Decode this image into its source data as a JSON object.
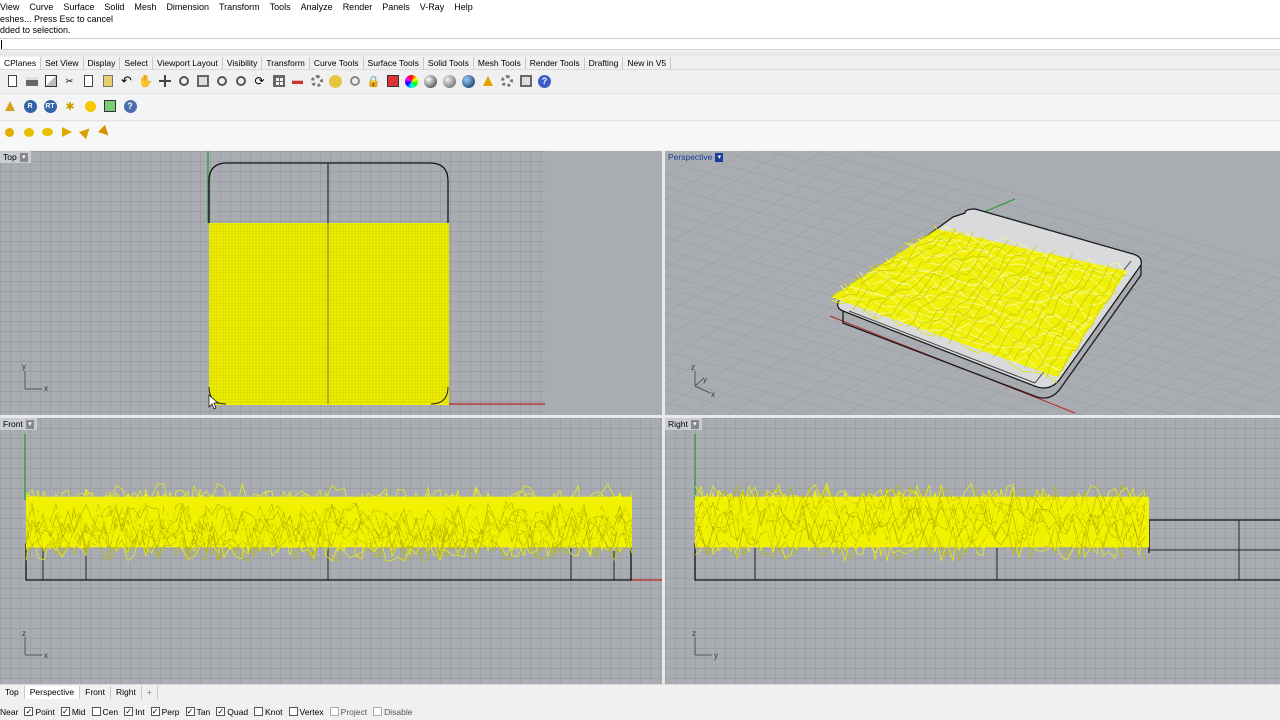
{
  "menu": [
    "View",
    "Curve",
    "Surface",
    "Solid",
    "Mesh",
    "Dimension",
    "Transform",
    "Tools",
    "Analyze",
    "Render",
    "Panels",
    "V-Ray",
    "Help"
  ],
  "command_history": [
    "eshes... Press Esc to cancel",
    "dded to selection."
  ],
  "command_prompt": "",
  "tabs": [
    "CPlanes",
    "Set View",
    "Display",
    "Select",
    "Viewport Layout",
    "Visibility",
    "Transform",
    "Curve Tools",
    "Surface Tools",
    "Solid Tools",
    "Mesh Tools",
    "Render Tools",
    "Drafting",
    "New in V5"
  ],
  "toolbar_icons": [
    "new-file-icon",
    "print-icon",
    "new-object-icon",
    "cut-icon",
    "copy-icon",
    "paste-icon",
    "undo-icon",
    "pan-hand-icon",
    "move-icon",
    "zoom-in-icon",
    "zoom-window-icon",
    "zoom-extents-icon",
    "zoom-selected-icon",
    "rotate-view-icon",
    "grid-icon",
    "car-icon",
    "snap-icon",
    "light-icon",
    "target-icon",
    "lock-icon",
    "material-icon",
    "color-wheel-icon",
    "sphere-icon",
    "render-sphere-icon",
    "blue-sphere-icon",
    "arrow-icon",
    "settings-icon",
    "options-icon",
    "help-icon"
  ],
  "toolbar2_icons": [
    "rhino-logo-icon",
    "render-r-icon",
    "rt-icon",
    "bee-icon",
    "sun-icon",
    "ortho-icon",
    "help-icon"
  ],
  "toolbar3_icons": [
    "yellow-ball-icon",
    "yellow-half-icon",
    "yellow-dome-icon",
    "yellow-flag-icon",
    "yellow-pin-icon",
    "yellow-arrow-icon"
  ],
  "viewports": {
    "top": {
      "label": "Top"
    },
    "perspective": {
      "label": "Perspective"
    },
    "front": {
      "label": "Front"
    },
    "right": {
      "label": "Right"
    }
  },
  "axes": {
    "x": "x",
    "y": "y",
    "z": "z"
  },
  "viewport_tabs": [
    "Top",
    "Perspective",
    "Front",
    "Right",
    "+"
  ],
  "osnaps": [
    {
      "label": "Near",
      "checked": false
    },
    {
      "label": "Point",
      "checked": true
    },
    {
      "label": "Mid",
      "checked": true
    },
    {
      "label": "Cen",
      "checked": false
    },
    {
      "label": "Int",
      "checked": true
    },
    {
      "label": "Perp",
      "checked": true
    },
    {
      "label": "Tan",
      "checked": true
    },
    {
      "label": "Quad",
      "checked": true
    },
    {
      "label": "Knot",
      "checked": false
    },
    {
      "label": "Vertex",
      "checked": false
    },
    {
      "label": "Project",
      "checked": false
    },
    {
      "label": "Disable",
      "checked": false
    }
  ],
  "colors": {
    "accent_active": "#1a3d9a",
    "mesh": "#f2f200",
    "viewport_bg": "#a9adb2",
    "grid": "#9c9fa5"
  }
}
